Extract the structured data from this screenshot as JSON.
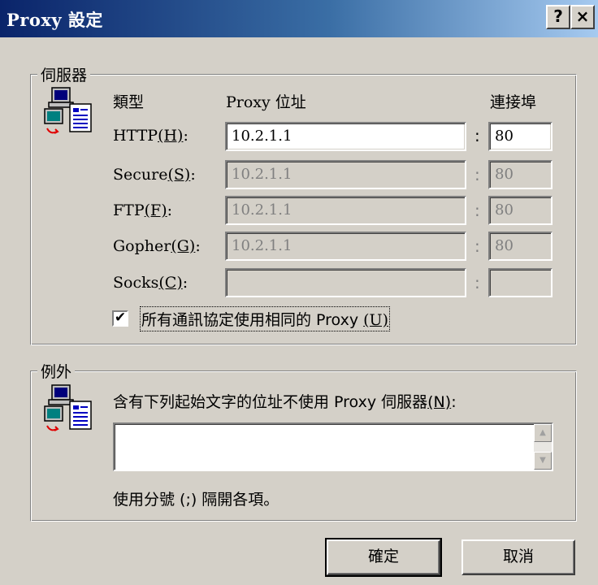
{
  "window": {
    "title": "Proxy 設定",
    "help_button": "?",
    "close_button": "×"
  },
  "servers": {
    "group_label": "伺服器",
    "col_type": "類型",
    "col_address": "Proxy 位址",
    "col_port": "連接埠",
    "colon": ":",
    "rows": [
      {
        "label": "HTTP",
        "accel": "(H)",
        "suffix": ":",
        "address": "10.2.1.1",
        "port": "80",
        "enabled": true
      },
      {
        "label": "Secure",
        "accel": "(S)",
        "suffix": ":",
        "address": "10.2.1.1",
        "port": "80",
        "enabled": false
      },
      {
        "label": "FTP",
        "accel": "(F)",
        "suffix": ":",
        "address": "10.2.1.1",
        "port": "80",
        "enabled": false
      },
      {
        "label": "Gopher",
        "accel": "(G)",
        "suffix": ":",
        "address": "10.2.1.1",
        "port": "80",
        "enabled": false
      },
      {
        "label": "Socks",
        "accel": "(C)",
        "suffix": ":",
        "address": "",
        "port": "",
        "enabled": false
      }
    ],
    "same_proxy_label": "所有通訊協定使用相同的 Proxy ",
    "same_proxy_accel": "(U)",
    "same_proxy_checked": true,
    "check_mark": "✔"
  },
  "exceptions": {
    "group_label": "例外",
    "description": "含有下列起始文字的位址不使用 Proxy 伺服器",
    "description_accel": "(N)",
    "description_suffix": ":",
    "value": "",
    "hint": "使用分號 (;) 隔開各項。",
    "scroll_up": "▲",
    "scroll_down": "▼"
  },
  "buttons": {
    "ok": "確定",
    "cancel": "取消"
  },
  "colors": {
    "title_start": "#0a246a",
    "title_end": "#a6caf0",
    "face": "#d4d0c8",
    "disabled_text": "#808080"
  },
  "icons": [
    "network-computer-icon",
    "network-computer-icon"
  ]
}
